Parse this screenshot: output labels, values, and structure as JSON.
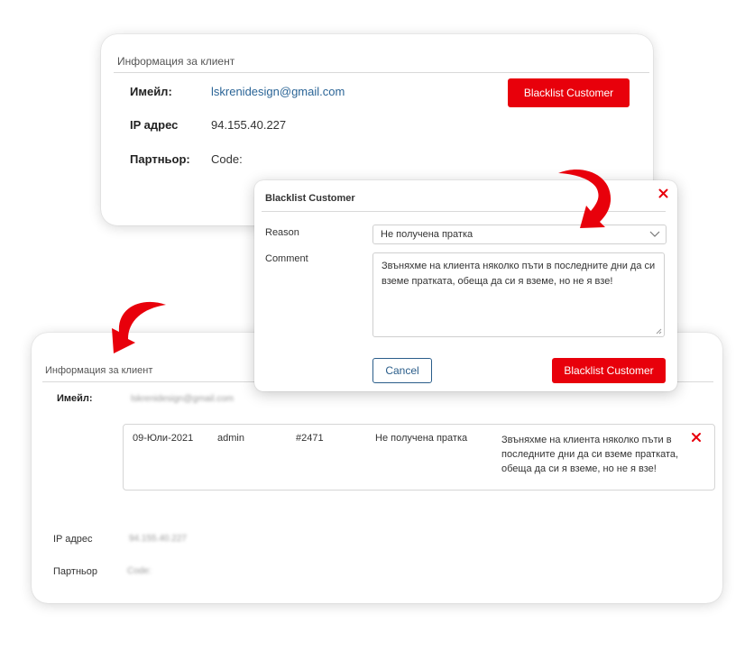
{
  "top_card": {
    "title": "Информация за клиент",
    "email_label": "Имейл:",
    "email_value": "lskrenidesign@gmail.com",
    "ip_label": "IP адрес",
    "ip_value": "94.155.40.227",
    "partner_label": "Партньор:",
    "partner_value": "Code:",
    "blacklist_button": "Blacklist Customer"
  },
  "modal": {
    "title": "Blacklist Customer",
    "close_icon": "close-icon",
    "reason_label": "Reason",
    "reason_value": "Не получена пратка",
    "comment_label": "Comment",
    "comment_value": "Звъняхме на клиента няколко пъти в последните дни да си вземе пратката, обеща да си я вземе, но не я взе!",
    "cancel_button": "Cancel",
    "submit_button": "Blacklist Customer"
  },
  "bottom_card": {
    "title": "Информация за клиент",
    "email_label": "Имейл:",
    "email_value": "lskrenidesign@gmail.com",
    "ip_label": "IP адрес",
    "ip_value": "94.155.40.227",
    "partner_label": "Партньор",
    "partner_value": "Code:",
    "entry": {
      "date": "09-Юли-2021",
      "user": "admin",
      "order": "#2471",
      "reason": "Не получена пратка",
      "comment": "Звъняхме на клиента няколко пъти в последните дни да си вземе пратката, обеща да си я вземе, но не я взе!",
      "remove_icon": "close-icon"
    }
  },
  "colors": {
    "accent_red": "#e8000b",
    "link_blue": "#2a6496",
    "outline_blue": "#2a5d8a"
  }
}
